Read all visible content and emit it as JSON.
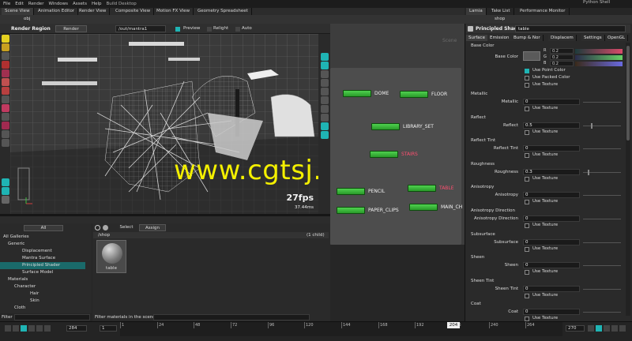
{
  "menubar": {
    "items": [
      "File",
      "Edit",
      "Render",
      "Windows",
      "Assets",
      "Help"
    ],
    "build": "Build Desktop",
    "right_tab": "Python Shell"
  },
  "pane_tabs": [
    "Scene View",
    "Animation Editor",
    "Render View",
    "Composite View",
    "Motion FX View",
    "Geometry Spreadsheet"
  ],
  "path_obj": "obj",
  "viewport": {
    "title": "Render Region",
    "render_button": "Render",
    "out_path": "/out/mantra1",
    "preview": "Preview",
    "relight": "Relight",
    "auto": "Auto",
    "fps": "27fps",
    "ms": "37.44ms",
    "scene_label": "Scene"
  },
  "network": {
    "nodes": [
      {
        "label": "DOME",
        "color": "#f2f2f2"
      },
      {
        "label": "FLOOR",
        "color": "#f2f2f2"
      },
      {
        "label": "LIBRARY_SET",
        "color": "#f2f2f2"
      },
      {
        "label": "STAIRS",
        "color": "#ff4f70"
      },
      {
        "label": "PENCIL",
        "color": "#f2f2f2"
      },
      {
        "label": "TABLE",
        "color": "#ff4f70"
      },
      {
        "label": "PAPER_CLIPS",
        "color": "#f2f2f2"
      },
      {
        "label": "MAIN_CH",
        "color": "#f2f2f2"
      }
    ]
  },
  "gallery": {
    "filter_all": "All",
    "items": [
      "All Galleries",
      "Generic",
      "Displacement",
      "Mantra Surface",
      "Principled Shader",
      "Surface Model",
      "Materials",
      "Character",
      "Hair",
      "Skin",
      "Cloth"
    ],
    "filter_label": "Filter"
  },
  "material_palette": {
    "select": "Select",
    "assign": "Assign",
    "path": "/shop",
    "child_count": "(1 child)",
    "material_name": "table",
    "filter_hint": "Filter materials in the scene:"
  },
  "properties": {
    "tabs_top": [
      "Lamia",
      "Take List",
      "Performance Monitor"
    ],
    "path": "shop",
    "shader_type": "Principled Shader",
    "shader_name": "table",
    "tabs": [
      "Surface",
      "Emission",
      "Bump & Nor",
      "Displacem",
      "Settings",
      "OpenGL"
    ],
    "base_color_section": "Base Color",
    "base_color_label": "Base Color",
    "rgb": [
      {
        "ch": "R",
        "val": "0.2"
      },
      {
        "ch": "G",
        "val": "0.2"
      },
      {
        "ch": "B",
        "val": "0.2"
      }
    ],
    "use_point_color": "Use Point Color",
    "use_packed_color": "Use Packed Color",
    "use_texture": "Use Texture",
    "sections": [
      {
        "title": "Metallic",
        "label": "Metallic",
        "value": "0"
      },
      {
        "title": "Reflect",
        "label": "Reflect",
        "value": "0.5"
      },
      {
        "title": "Reflect Tint",
        "label": "Reflect Tint",
        "value": "0"
      },
      {
        "title": "Roughness",
        "label": "Roughness",
        "value": "0.3"
      },
      {
        "title": "Anisotropy",
        "label": "Anisotropy",
        "value": "0"
      },
      {
        "title": "Anisotropy Direction",
        "label": "Anisotropy Direction",
        "value": "0"
      },
      {
        "title": "Subsurface",
        "label": "Subsurface",
        "value": "0"
      },
      {
        "title": "Sheen",
        "label": "Sheen",
        "value": "0"
      },
      {
        "title": "Sheen Tint",
        "label": "Sheen Tint",
        "value": "0"
      },
      {
        "title": "Coat",
        "label": "Coat",
        "value": "0"
      }
    ]
  },
  "timeline": {
    "current_frame": "284",
    "start": "1",
    "end": "270",
    "marker": "204",
    "ticks": [
      "1",
      "24",
      "48",
      "72",
      "96",
      "120",
      "144",
      "168",
      "192",
      "216",
      "240",
      "264"
    ]
  },
  "watermark": "www.cgtsj.com",
  "colors": {
    "accent_teal": "#1fb4b4",
    "node_green": "#3fbf3f",
    "watermark_yellow": "#f4f000"
  }
}
